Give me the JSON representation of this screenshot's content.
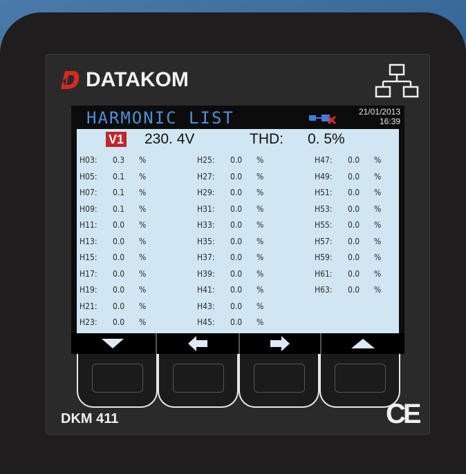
{
  "device": {
    "brand": "DATAKOM",
    "model": "DKM 411",
    "certification": "CE",
    "network_icon": "network-topology-icon"
  },
  "screen": {
    "title": "HARMONIC LIST",
    "date": "21/01/2013",
    "time": "16:39",
    "status_icons": [
      "connection-icon",
      "error-icon"
    ],
    "channel": "V1",
    "voltage": "230. 4V",
    "thd_label": "THD:",
    "thd_value": "0. 5%",
    "columns": [
      [
        {
          "h": "H03:",
          "v": "0.3",
          "u": "%"
        },
        {
          "h": "H05:",
          "v": "0.1",
          "u": "%"
        },
        {
          "h": "H07:",
          "v": "0.1",
          "u": "%"
        },
        {
          "h": "H09:",
          "v": "0.1",
          "u": "%"
        },
        {
          "h": "H11:",
          "v": "0.0",
          "u": "%"
        },
        {
          "h": "H13:",
          "v": "0.0",
          "u": "%"
        },
        {
          "h": "H15:",
          "v": "0.0",
          "u": "%"
        },
        {
          "h": "H17:",
          "v": "0.0",
          "u": "%"
        },
        {
          "h": "H19:",
          "v": "0.0",
          "u": "%"
        },
        {
          "h": "H21:",
          "v": "0.0",
          "u": "%"
        },
        {
          "h": "H23:",
          "v": "0.0",
          "u": "%"
        }
      ],
      [
        {
          "h": "H25:",
          "v": "0.0",
          "u": "%"
        },
        {
          "h": "H27:",
          "v": "0.0",
          "u": "%"
        },
        {
          "h": "H29:",
          "v": "0.0",
          "u": "%"
        },
        {
          "h": "H31:",
          "v": "0.0",
          "u": "%"
        },
        {
          "h": "H33:",
          "v": "0.0",
          "u": "%"
        },
        {
          "h": "H35:",
          "v": "0.0",
          "u": "%"
        },
        {
          "h": "H37:",
          "v": "0.0",
          "u": "%"
        },
        {
          "h": "H39:",
          "v": "0.0",
          "u": "%"
        },
        {
          "h": "H41:",
          "v": "0.0",
          "u": "%"
        },
        {
          "h": "H43:",
          "v": "0.0",
          "u": "%"
        },
        {
          "h": "H45:",
          "v": "0.0",
          "u": "%"
        }
      ],
      [
        {
          "h": "H47:",
          "v": "0.0",
          "u": "%"
        },
        {
          "h": "H49:",
          "v": "0.0",
          "u": "%"
        },
        {
          "h": "H51:",
          "v": "0.0",
          "u": "%"
        },
        {
          "h": "H53:",
          "v": "0.0",
          "u": "%"
        },
        {
          "h": "H55:",
          "v": "0.0",
          "u": "%"
        },
        {
          "h": "H57:",
          "v": "0.0",
          "u": "%"
        },
        {
          "h": "H59:",
          "v": "0.0",
          "u": "%"
        },
        {
          "h": "H61:",
          "v": "0.0",
          "u": "%"
        },
        {
          "h": "H63:",
          "v": "0.0",
          "u": "%"
        }
      ]
    ],
    "softkeys": [
      {
        "name": "down-arrow-icon"
      },
      {
        "name": "left-arrow-icon"
      },
      {
        "name": "right-arrow-icon"
      },
      {
        "name": "up-arrow-icon"
      }
    ]
  },
  "colors": {
    "title": "#4f8fd6",
    "channel_badge": "#c0262a",
    "content_bg": "#d0e6f2",
    "logo_red": "#d42a22"
  }
}
